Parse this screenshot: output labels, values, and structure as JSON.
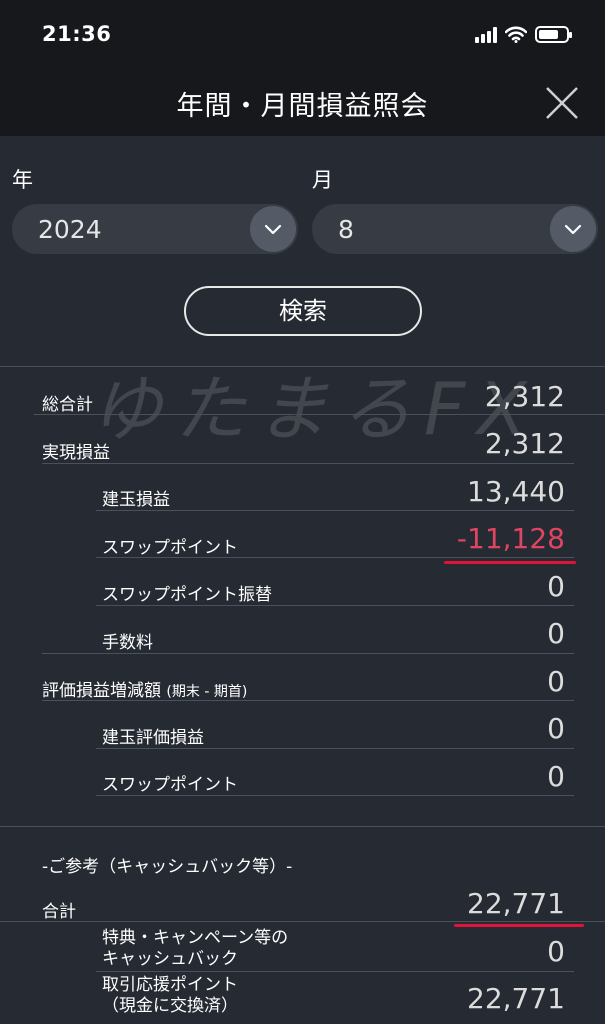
{
  "status_bar": {
    "time": "21:36"
  },
  "header": {
    "title": "年間・月間損益照会"
  },
  "filters": {
    "year_label": "年",
    "year_value": "2024",
    "month_label": "月",
    "month_value": "8"
  },
  "search": {
    "label": "検索"
  },
  "watermark": "ゆたまるFX",
  "summary": {
    "total": {
      "label": "総合計",
      "value": "2,312"
    },
    "realized": {
      "label": "実現損益",
      "value": "2,312"
    },
    "position_pl": {
      "label": "建玉損益",
      "value": "13,440"
    },
    "swap_point": {
      "label": "スワップポイント",
      "value": "-11,128"
    },
    "swap_transfer": {
      "label": "スワップポイント振替",
      "value": "0"
    },
    "fee": {
      "label": "手数料",
      "value": "0"
    },
    "valuation_change": {
      "label": "評価損益増減額",
      "label_suffix": "(期末 - 期首)",
      "value": "0"
    },
    "position_valuation": {
      "label": "建玉評価損益",
      "value": "0"
    },
    "swap_point_valuation": {
      "label": "スワップポイント",
      "value": "0"
    }
  },
  "reference": {
    "heading": "-ご参考（キャッシュバック等）-",
    "total": {
      "label": "合計",
      "value": "22,771"
    },
    "campaign": {
      "label_line1": "特典・キャンペーン等の",
      "label_line2": "キャッシュバック",
      "value": "0"
    },
    "support": {
      "label_line1": "取引応援ポイント",
      "label_line2": "（現金に交換済）",
      "value": "22,771"
    }
  },
  "colors": {
    "background": "#262b33",
    "header": "#16181c",
    "negative": "#e04463",
    "highlight_underline": "#e0133a"
  },
  "icons": {
    "close": "close-icon",
    "chevron": "chevron-down-icon",
    "signal": "signal-icon",
    "wifi": "wifi-icon",
    "battery": "battery-icon"
  }
}
